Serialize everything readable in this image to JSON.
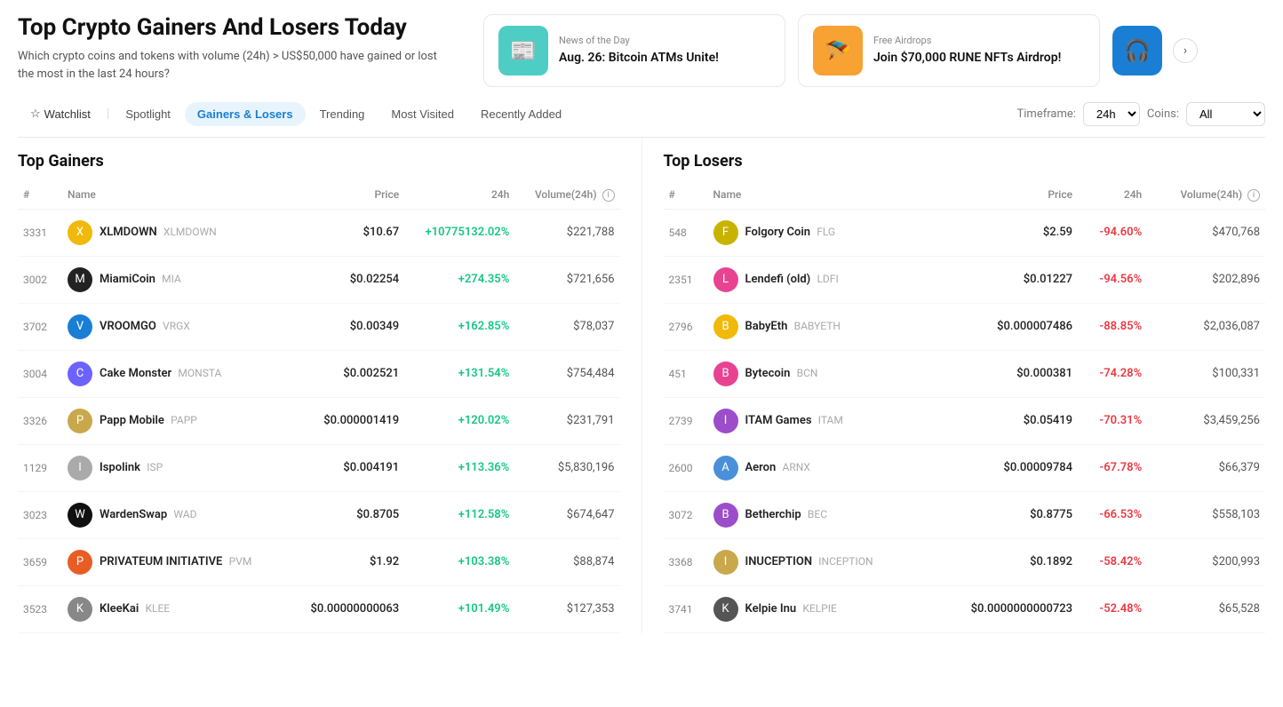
{
  "page": {
    "title": "Top Crypto Gainers And Losers Today",
    "subtitle": "Which crypto coins and tokens with volume (24h) > US$50,000 have gained or lost the most in the last 24 hours?"
  },
  "news_cards": [
    {
      "id": "card1",
      "icon": "📰",
      "icon_bg": "teal",
      "label": "News of the Day",
      "title": "Aug. 26: Bitcoin ATMs Unite!"
    },
    {
      "id": "card2",
      "icon": "🪂",
      "icon_bg": "orange",
      "label": "Free Airdrops",
      "title": "Join $70,000 RUNE NFTs Airdrop!"
    }
  ],
  "nav": {
    "tabs": [
      {
        "id": "watchlist",
        "label": "Watchlist",
        "active": false,
        "icon": "☆"
      },
      {
        "id": "spotlight",
        "label": "Spotlight",
        "active": false
      },
      {
        "id": "gainers-losers",
        "label": "Gainers & Losers",
        "active": true
      },
      {
        "id": "trending",
        "label": "Trending",
        "active": false
      },
      {
        "id": "most-visited",
        "label": "Most Visited",
        "active": false
      },
      {
        "id": "recently-added",
        "label": "Recently Added",
        "active": false
      }
    ],
    "timeframe_label": "Timeframe:",
    "timeframe_value": "24h",
    "coins_label": "Coins:",
    "coins_value": "All"
  },
  "gainers": {
    "title": "Top Gainers",
    "columns": [
      "#",
      "Name",
      "Price",
      "24h",
      "Volume(24h)"
    ],
    "rows": [
      {
        "rank": "3331",
        "name": "XLMDOWN",
        "symbol": "XLMDOWN",
        "price": "$10.67",
        "change": "+10775132.02%",
        "volume": "$221,788",
        "color": "#f0b90b"
      },
      {
        "rank": "3002",
        "name": "MiamiCoin",
        "symbol": "MIA",
        "price": "$0.02254",
        "change": "+274.35%",
        "volume": "$721,656",
        "color": "#222"
      },
      {
        "rank": "3702",
        "name": "VROOMGO",
        "symbol": "VRGX",
        "price": "$0.00349",
        "change": "+162.85%",
        "volume": "$78,037",
        "color": "#1a7fd4"
      },
      {
        "rank": "3004",
        "name": "Cake Monster",
        "symbol": "MONSTA",
        "price": "$0.002521",
        "change": "+131.54%",
        "volume": "$754,484",
        "color": "#6c63ff"
      },
      {
        "rank": "3326",
        "name": "Papp Mobile",
        "symbol": "PAPP",
        "price": "$0.000001419",
        "change": "+120.02%",
        "volume": "$231,791",
        "color": "#c8a84b"
      },
      {
        "rank": "1129",
        "name": "Ispolink",
        "symbol": "ISP",
        "price": "$0.004191",
        "change": "+113.36%",
        "volume": "$5,830,196",
        "color": "#aaa"
      },
      {
        "rank": "3023",
        "name": "WardenSwap",
        "symbol": "WAD",
        "price": "$0.8705",
        "change": "+112.58%",
        "volume": "$674,647",
        "color": "#111"
      },
      {
        "rank": "3659",
        "name": "PRIVATEUM INITIATIVE",
        "symbol": "PVM",
        "price": "$1.92",
        "change": "+103.38%",
        "volume": "$88,874",
        "color": "#e85d26"
      },
      {
        "rank": "3523",
        "name": "KleeKai",
        "symbol": "KLEE",
        "price": "$0.00000000063",
        "change": "+101.49%",
        "volume": "$127,353",
        "color": "#888"
      }
    ]
  },
  "losers": {
    "title": "Top Losers",
    "columns": [
      "#",
      "Name",
      "Price",
      "24h",
      "Volume(24h)"
    ],
    "rows": [
      {
        "rank": "548",
        "name": "Folgory Coin",
        "symbol": "FLG",
        "price": "$2.59",
        "change": "-94.60%",
        "volume": "$470,768",
        "color": "#c8b400"
      },
      {
        "rank": "2351",
        "name": "Lendefi (old)",
        "symbol": "LDFI",
        "price": "$0.01227",
        "change": "-94.56%",
        "volume": "$202,896",
        "color": "#e84393"
      },
      {
        "rank": "2796",
        "name": "BabyEth",
        "symbol": "BABYETH",
        "price": "$0.000007486",
        "change": "-88.85%",
        "volume": "$2,036,087",
        "color": "#f0b90b"
      },
      {
        "rank": "451",
        "name": "Bytecoin",
        "symbol": "BCN",
        "price": "$0.000381",
        "change": "-74.28%",
        "volume": "$100,331",
        "color": "#e84393"
      },
      {
        "rank": "2739",
        "name": "ITAM Games",
        "symbol": "ITAM",
        "price": "$0.05419",
        "change": "-70.31%",
        "volume": "$3,459,256",
        "color": "#9b4dca"
      },
      {
        "rank": "2600",
        "name": "Aeron",
        "symbol": "ARNX",
        "price": "$0.00009784",
        "change": "-67.78%",
        "volume": "$66,379",
        "color": "#4a90d9"
      },
      {
        "rank": "3072",
        "name": "Betherchip",
        "symbol": "BEC",
        "price": "$0.8775",
        "change": "-66.53%",
        "volume": "$558,103",
        "color": "#9b4dca"
      },
      {
        "rank": "3368",
        "name": "INUCEPTION",
        "symbol": "INCEPTION",
        "price": "$0.1892",
        "change": "-58.42%",
        "volume": "$200,993",
        "color": "#c8a84b"
      },
      {
        "rank": "3741",
        "name": "Kelpie Inu",
        "symbol": "KELPIE",
        "price": "$0.0000000000723",
        "change": "-52.48%",
        "volume": "$65,528",
        "color": "#555"
      }
    ]
  }
}
